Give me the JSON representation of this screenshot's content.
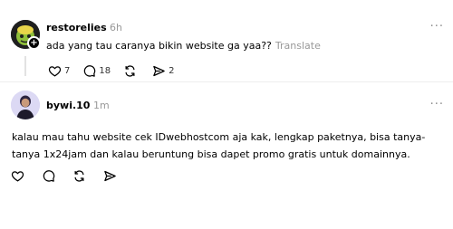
{
  "post": {
    "username": "restorelies",
    "time": "6h",
    "text": "ada yang tau caranya bikin website ga yaa??",
    "translate_label": "Translate",
    "more_label": "···",
    "likes": "7",
    "replies": "18",
    "reposts": "",
    "shares": "2"
  },
  "reply": {
    "username": "bywi.10",
    "time": "1m",
    "text": "kalau mau tahu website cek IDwebhostcom aja kak, lengkap paketnya, bisa tanya-tanya 1x24jam dan kalau beruntung bisa dapet promo gratis untuk domainnya.",
    "more_label": "···"
  },
  "colors": {
    "muted": "#999999",
    "divider": "#eeeeee",
    "avatar2_bg": "#dcd9f4"
  }
}
